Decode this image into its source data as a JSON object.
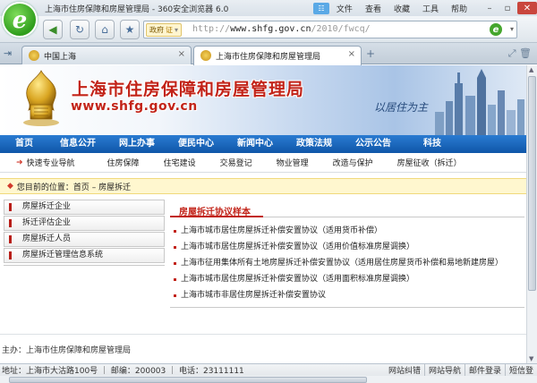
{
  "browser": {
    "window_title": "上海市住房保障和房屋管理局 - 360安全浏览器 6.0",
    "menu": [
      "文件",
      "查看",
      "收藏",
      "工具",
      "帮助"
    ],
    "url_badge": "政府",
    "url_cert": "证",
    "url_prefix": "http://",
    "url_host": "www.shfg.gov.cn",
    "url_path": "/2010/fwcq/",
    "tabs": [
      {
        "label": "中国上海",
        "active": false
      },
      {
        "label": "上海市住房保障和房屋管理局",
        "active": true
      }
    ]
  },
  "site": {
    "name": "上海市住房保障和房屋管理局",
    "url": "www.shfg.gov.cn",
    "slogan": "以居住为主"
  },
  "main_nav": [
    "首页",
    "信息公开",
    "网上办事",
    "便民中心",
    "新闻中心",
    "政策法规",
    "公示公告",
    "科技"
  ],
  "sub_nav": {
    "label": "快速专业导航",
    "items": [
      "住房保障",
      "住宅建设",
      "交易登记",
      "物业管理",
      "改造与保护",
      "房屋征收（拆迁）"
    ]
  },
  "location": {
    "text": "您目前的位置：首页 – 房屋拆迁"
  },
  "left_menu": [
    "房屋拆迁企业",
    "拆迁评估企业",
    "房屋拆迁人员",
    "房屋拆迁管理信息系统"
  ],
  "content": {
    "title": "房屋拆迁协议样本",
    "items": [
      "上海市城市居住房屋拆迁补偿安置协议（适用货币补偿）",
      "上海市城市居住房屋拆迁补偿安置协议（适用价值标准房屋调换）",
      "上海市征用集体所有土地房屋拆迁补偿安置协议（适用居住房屋货币补偿和易地新建房屋）",
      "上海市城市居住房屋拆迁补偿安置协议（适用面积标准房屋调换）",
      "上海市城市非居住房屋拆迁补偿安置协议"
    ]
  },
  "footer": {
    "sponsor": "主办：上海市住房保障和房屋管理局",
    "address_line": "地址：上海市大沽路100号 ｜ 邮编：200003 ｜ 电话：23111111",
    "links": [
      "网站纠错",
      "网站导航",
      "邮件登录",
      "短信登"
    ]
  }
}
